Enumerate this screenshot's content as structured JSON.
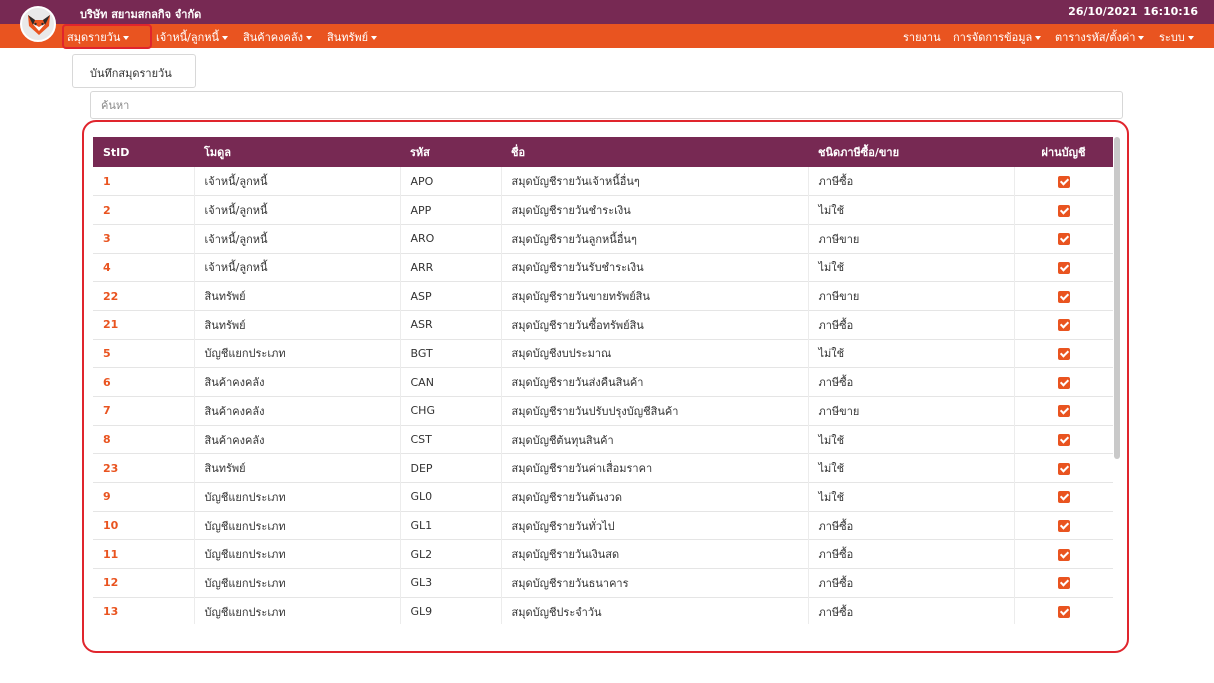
{
  "header": {
    "company": "บริษัท สยามสกลกิจ จำกัด",
    "datetime": "26/10/2021   16:10:16"
  },
  "menu": {
    "left": [
      {
        "label": "สมุดรายวัน"
      },
      {
        "label": "เจ้าหนี้/ลูกหนี้"
      },
      {
        "label": "สินค้าคงคลัง"
      },
      {
        "label": "สินทรัพย์"
      }
    ],
    "right": [
      {
        "label": "รายงาน"
      },
      {
        "label": "การจัดการข้อมูล"
      },
      {
        "label": "ตารางรหัส/ตั้งค่า"
      },
      {
        "label": "ระบบ"
      }
    ]
  },
  "dropdown": {
    "item": "บันทึกสมุดรายวัน"
  },
  "search": {
    "placeholder": "ค้นหา",
    "value": ""
  },
  "table": {
    "columns": [
      "StID",
      "โมดูล",
      "รหัส",
      "ชื่อ",
      "ชนิดภาษีซื้อ/ขาย",
      "ผ่านบัญชี"
    ],
    "rows": [
      {
        "stid": "1",
        "module": "เจ้าหนี้/ลูกหนี้",
        "code": "APO",
        "name": "สมุดบัญชีรายวันเจ้าหนี้อื่นๆ",
        "tax": "ภาษีซื้อ",
        "posted": true
      },
      {
        "stid": "2",
        "module": "เจ้าหนี้/ลูกหนี้",
        "code": "APP",
        "name": "สมุดบัญชีรายวันชำระเงิน",
        "tax": "ไม่ใช้",
        "posted": true
      },
      {
        "stid": "3",
        "module": "เจ้าหนี้/ลูกหนี้",
        "code": "ARO",
        "name": "สมุดบัญชีรายวันลูกหนี้อื่นๆ",
        "tax": "ภาษีขาย",
        "posted": true
      },
      {
        "stid": "4",
        "module": "เจ้าหนี้/ลูกหนี้",
        "code": "ARR",
        "name": "สมุดบัญชีรายวันรับชำระเงิน",
        "tax": "ไม่ใช้",
        "posted": true
      },
      {
        "stid": "22",
        "module": "สินทรัพย์",
        "code": "ASP",
        "name": "สมุดบัญชีรายวันขายทรัพย์สิน",
        "tax": "ภาษีขาย",
        "posted": true
      },
      {
        "stid": "21",
        "module": "สินทรัพย์",
        "code": "ASR",
        "name": "สมุดบัญชีรายวันซื้อทรัพย์สิน",
        "tax": "ภาษีซื้อ",
        "posted": true
      },
      {
        "stid": "5",
        "module": "บัญชีแยกประเภท",
        "code": "BGT",
        "name": "สมุดบัญชีงบประมาณ",
        "tax": "ไม่ใช้",
        "posted": true
      },
      {
        "stid": "6",
        "module": "สินค้าคงคลัง",
        "code": "CAN",
        "name": "สมุดบัญชีรายวันส่งคืนสินค้า",
        "tax": "ภาษีซื้อ",
        "posted": true
      },
      {
        "stid": "7",
        "module": "สินค้าคงคลัง",
        "code": "CHG",
        "name": "สมุดบัญชีรายวันปรับปรุงบัญชีสินค้า",
        "tax": "ภาษีขาย",
        "posted": true
      },
      {
        "stid": "8",
        "module": "สินค้าคงคลัง",
        "code": "CST",
        "name": "สมุดบัญชีต้นทุนสินค้า",
        "tax": "ไม่ใช้",
        "posted": true
      },
      {
        "stid": "23",
        "module": "สินทรัพย์",
        "code": "DEP",
        "name": "สมุดบัญชีรายวันค่าเสื่อมราคา",
        "tax": "ไม่ใช้",
        "posted": true
      },
      {
        "stid": "9",
        "module": "บัญชีแยกประเภท",
        "code": "GL0",
        "name": "สมุดบัญชีรายวันต้นงวด",
        "tax": "ไม่ใช้",
        "posted": true
      },
      {
        "stid": "10",
        "module": "บัญชีแยกประเภท",
        "code": "GL1",
        "name": "สมุดบัญชีรายวันทั่วไป",
        "tax": "ภาษีซื้อ",
        "posted": true
      },
      {
        "stid": "11",
        "module": "บัญชีแยกประเภท",
        "code": "GL2",
        "name": "สมุดบัญชีรายวันเงินสด",
        "tax": "ภาษีซื้อ",
        "posted": true
      },
      {
        "stid": "12",
        "module": "บัญชีแยกประเภท",
        "code": "GL3",
        "name": "สมุดบัญชีรายวันธนาคาร",
        "tax": "ภาษีซื้อ",
        "posted": true
      },
      {
        "stid": "13",
        "module": "บัญชีแยกประเภท",
        "code": "GL9",
        "name": "สมุดบัญชีประจำวัน",
        "tax": "ภาษีซื้อ",
        "posted": true
      }
    ]
  },
  "colors": {
    "primary": "#772953",
    "accent": "#e95420",
    "highlight": "#e0252d"
  },
  "icons": {
    "logo": "fox-logo-icon",
    "caret": "caret-down-icon",
    "check": "checkbox-checked-icon"
  }
}
